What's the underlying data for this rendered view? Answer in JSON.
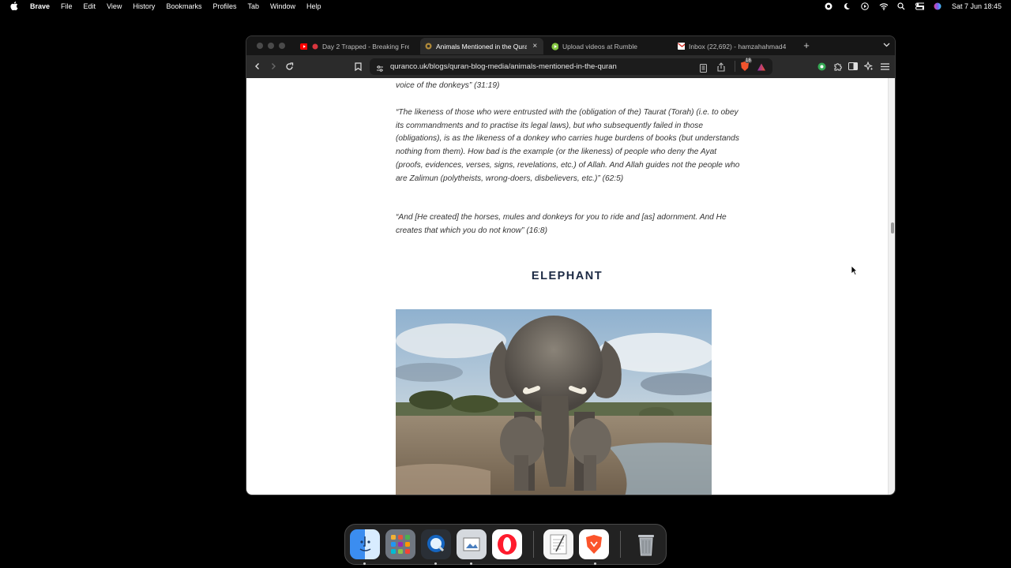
{
  "menubar": {
    "app_name": "Brave",
    "items": [
      "File",
      "Edit",
      "View",
      "History",
      "Bookmarks",
      "Profiles",
      "Tab",
      "Window",
      "Help"
    ],
    "clock": "Sat 7 Jun  18:45",
    "status_icons": [
      "screen-record-icon",
      "moon-icon",
      "play-circle-icon",
      "wifi-icon",
      "search-icon",
      "control-center-icon",
      "siri-icon"
    ]
  },
  "browser": {
    "tabs": [
      {
        "title": "Day 2 Trapped - Breaking Free",
        "favicon": "youtube-icon",
        "active": false
      },
      {
        "title": "Animals Mentioned in the Quran",
        "favicon": "quranco-icon",
        "active": true
      },
      {
        "title": "Upload videos at Rumble",
        "favicon": "rumble-icon",
        "active": false
      },
      {
        "title": "Inbox (22,692) - hamzahahmad4",
        "favicon": "gmail-icon",
        "active": false
      }
    ],
    "new_tab_label": "+",
    "url": "quranco.uk/blogs/quran-blog-media/animals-mentioned-in-the-quran",
    "brave_shield_count": "18"
  },
  "page": {
    "quote_top": "voice of the donkeys” (31:19)",
    "quote_1": "“The likeness of those who were entrusted with the (obligation of the) Taurat (Torah) (i.e. to obey its commandments and to practise its legal laws), but who subsequently failed in those (obligations), is as the likeness of a donkey who carries huge burdens of books (but understands nothing from them). How bad is the example (or the likeness) of people who deny the Ayat (proofs, evidences, verses, signs, revelations, etc.) of Allah. And Allah guides not the people who are Zalimun (polytheists, wrong-doers, disbelievers, etc.)” (62:5)",
    "quote_2": "“And [He created] the horses, mules and donkeys for you to ride and [as] adornment. And He creates that which you do not know” (16:8)",
    "heading": "ELEPHANT"
  },
  "dock": {
    "apps": [
      "finder-icon",
      "launchpad-icon",
      "quicktime-icon",
      "preview-icon",
      "opera-icon",
      "textedit-icon",
      "brave-icon",
      "trash-icon"
    ]
  },
  "colors": {
    "heading": "#1c2a44",
    "body_text": "#333333",
    "window_bg": "#1f1f1f"
  }
}
